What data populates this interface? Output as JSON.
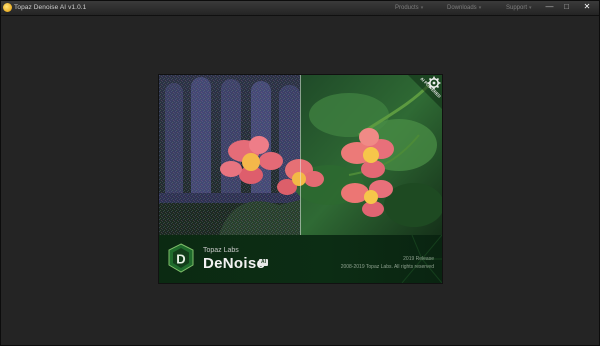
{
  "window": {
    "title": "Topaz Denoise AI v1.0.1",
    "app_icon": "topaz-app-icon"
  },
  "menu": [
    {
      "label": "Products",
      "icon": "chevron-down-icon"
    },
    {
      "label": "Downloads",
      "icon": "chevron-down-icon"
    },
    {
      "label": "Support",
      "icon": "chevron-down-icon"
    }
  ],
  "window_controls": {
    "minimize": "—",
    "maximize": "□",
    "close": "✕"
  },
  "splash": {
    "badge_text": "AI POWERED",
    "badge_icon": "gear-icon",
    "brand": "Topaz Labs",
    "product": "DeNoise",
    "product_tag": "AI",
    "release": "2019 Release",
    "copyright": "2008-2019 Topaz Labs. All rights reserved",
    "colors": {
      "brand_green": "#1f6b2c",
      "band_bg": "#0c2d14",
      "flower_pink": "#e8707a",
      "flower_center": "#f5c24a"
    }
  }
}
